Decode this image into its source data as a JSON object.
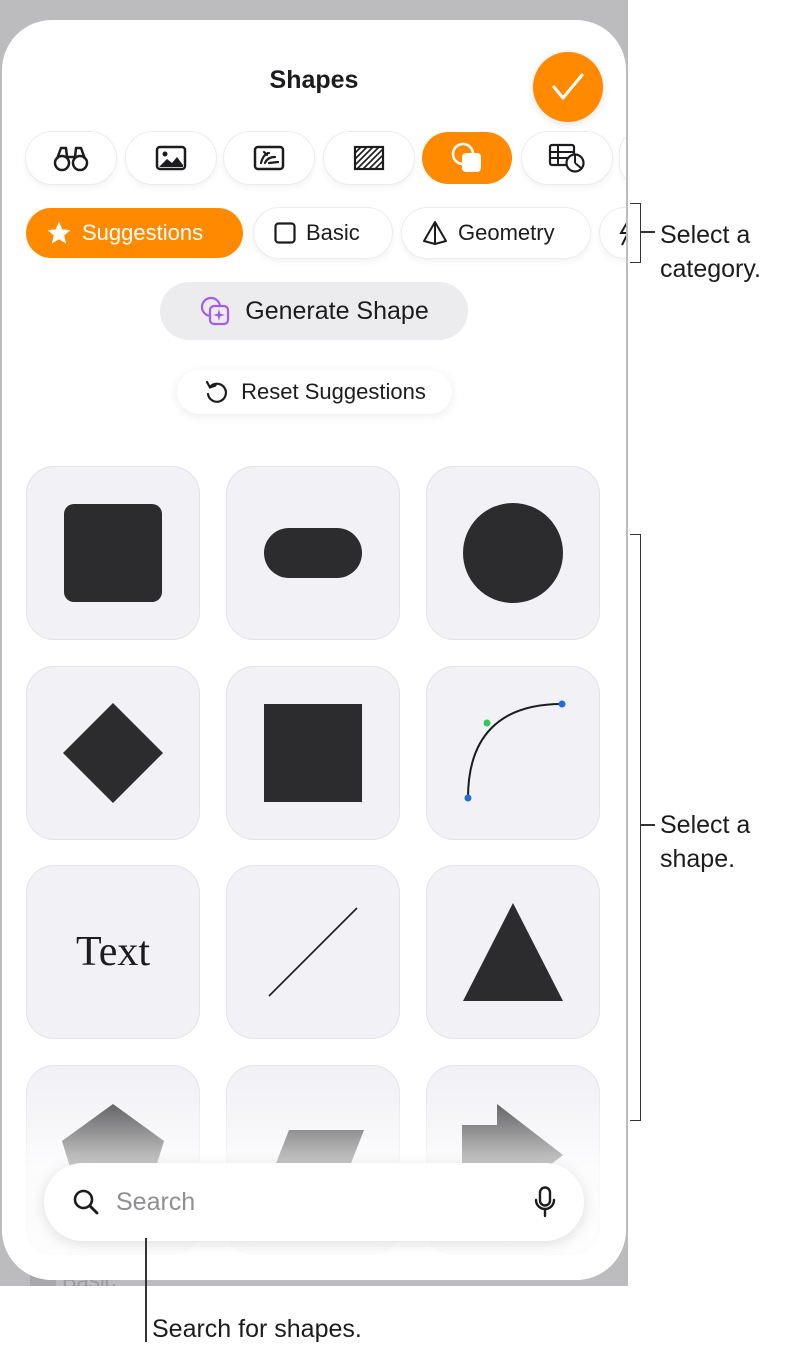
{
  "sheet": {
    "title": "Shapes",
    "peek_label": "Basic"
  },
  "toolbar_tabs": [
    {
      "icon": "binoculars-icon",
      "active": false
    },
    {
      "icon": "photo-icon",
      "active": false
    },
    {
      "icon": "image-gallery-icon",
      "active": false
    },
    {
      "icon": "hatch-pattern-icon",
      "active": false
    },
    {
      "icon": "shapes-icon",
      "active": true
    },
    {
      "icon": "table-chart-icon",
      "active": false
    }
  ],
  "categories": [
    {
      "label": "Suggestions",
      "icon": "star-icon",
      "active": true
    },
    {
      "label": "Basic",
      "icon": "square-outline-icon",
      "active": false
    },
    {
      "label": "Geometry",
      "icon": "pyramid-icon",
      "active": false
    }
  ],
  "actions": {
    "generate_label": "Generate Shape",
    "reset_label": "Reset Suggestions"
  },
  "shapes": [
    {
      "name": "rounded-rectangle"
    },
    {
      "name": "pill"
    },
    {
      "name": "circle"
    },
    {
      "name": "diamond"
    },
    {
      "name": "square"
    },
    {
      "name": "curve"
    },
    {
      "name": "text",
      "label": "Text"
    },
    {
      "name": "line"
    },
    {
      "name": "triangle"
    },
    {
      "name": "pentagon"
    },
    {
      "name": "parallelogram"
    },
    {
      "name": "arrow"
    }
  ],
  "search": {
    "placeholder": "Search"
  },
  "callouts": {
    "category": "Select a category.",
    "shape": "Select a shape.",
    "search": "Search for shapes."
  },
  "colors": {
    "accent": "#ff8a00",
    "shape_fill": "#2c2c2e",
    "tile_bg": "#f1f1f6",
    "curve_control_green": "#34c759",
    "curve_handle_blue": "#1e6fd9"
  }
}
